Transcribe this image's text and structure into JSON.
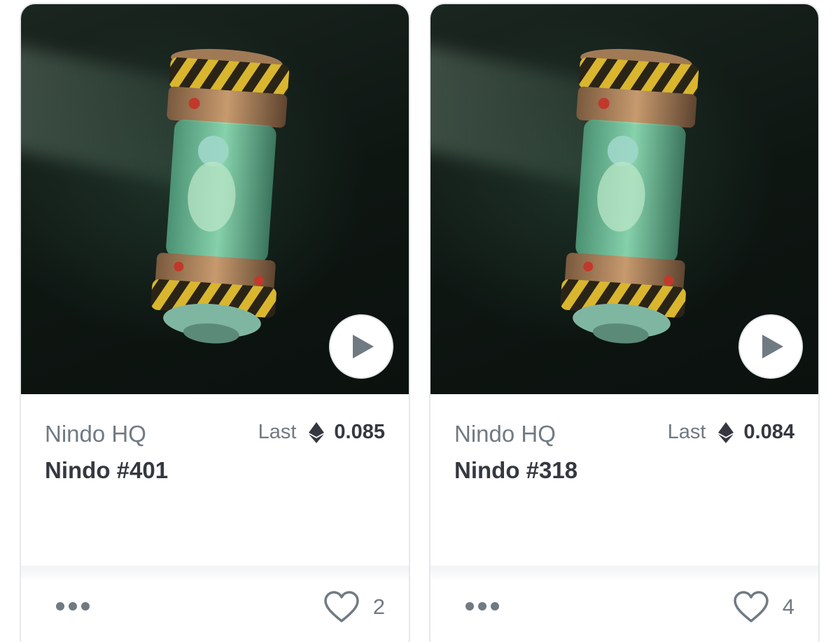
{
  "cards": [
    {
      "collection": "Nindo HQ",
      "name": "Nindo #401",
      "price_label": "Last",
      "price_value": "0.085",
      "favorites": "2",
      "media_icon": "play-icon",
      "currency_icon": "ethereum-icon"
    },
    {
      "collection": "Nindo HQ",
      "name": "Nindo #318",
      "price_label": "Last",
      "price_value": "0.084",
      "favorites": "4",
      "media_icon": "play-icon",
      "currency_icon": "ethereum-icon"
    }
  ],
  "colors": {
    "muted_text": "#707a83",
    "primary_text": "#353840",
    "border": "#e5e8eb"
  }
}
